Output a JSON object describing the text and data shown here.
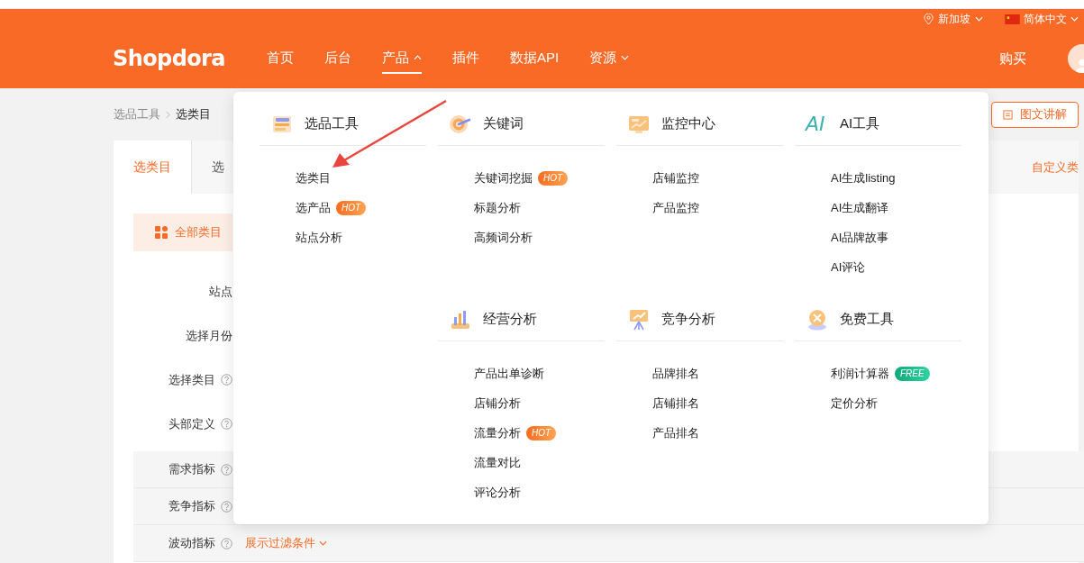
{
  "top_bar": {
    "region": "新加坡",
    "language": "简体中文"
  },
  "nav": {
    "logo": "Shopdora",
    "items": [
      {
        "label": "首页",
        "selected": false,
        "dropdown": false
      },
      {
        "label": "后台",
        "selected": false,
        "dropdown": false
      },
      {
        "label": "产品",
        "selected": true,
        "dropdown": true
      },
      {
        "label": "插件",
        "selected": false,
        "dropdown": false
      },
      {
        "label": "数据API",
        "selected": false,
        "dropdown": false
      },
      {
        "label": "资源",
        "selected": false,
        "dropdown": true
      }
    ],
    "buy": "购买"
  },
  "breadcrumb": [
    "选品工具",
    "选类目"
  ],
  "guide_button": "图文讲解",
  "tabs": [
    {
      "label": "选类目",
      "selected": true
    },
    {
      "label": "选",
      "selected": false
    }
  ],
  "custom_link": "自定义类",
  "category_button": "全部类目",
  "form_fields": [
    {
      "label": "站点",
      "help": false
    },
    {
      "label": "选择月份",
      "help": false
    },
    {
      "label": "选择类目",
      "help": true
    },
    {
      "label": "头部定义",
      "help": true
    }
  ],
  "filter_rows": [
    {
      "label": "需求指标"
    },
    {
      "label": "竞争指标"
    },
    {
      "label": "波动指标",
      "toggle": "展示过滤条件"
    }
  ],
  "menu": {
    "rows": [
      [
        {
          "title": "选品工具",
          "kind": "list",
          "items": [
            {
              "label": "选类目"
            },
            {
              "label": "选产品",
              "badge": {
                "text": "HOT",
                "kind": "hot"
              }
            },
            {
              "label": "站点分析"
            }
          ]
        },
        {
          "title": "关键词",
          "kind": "target",
          "items": [
            {
              "label": "关键词挖掘",
              "badge": {
                "text": "HOT",
                "kind": "hot"
              }
            },
            {
              "label": "标题分析"
            },
            {
              "label": "高频词分析"
            }
          ]
        },
        {
          "title": "监控中心",
          "kind": "monitor",
          "items": [
            {
              "label": "店铺监控"
            },
            {
              "label": "产品监控"
            }
          ]
        },
        {
          "title": "AI工具",
          "kind": "ai",
          "icon_text": "AI",
          "items": [
            {
              "label": "AI生成listing"
            },
            {
              "label": "AI生成翻译"
            },
            {
              "label": "AI品牌故事"
            },
            {
              "label": "AI评论"
            }
          ]
        }
      ],
      [
        "",
        {
          "title": "经营分析",
          "kind": "bars",
          "items": [
            {
              "label": "产品出单诊断"
            },
            {
              "label": "店铺分析"
            },
            {
              "label": "流量分析",
              "badge": {
                "text": "HOT",
                "kind": "hot"
              }
            },
            {
              "label": "流量对比"
            },
            {
              "label": "评论分析"
            }
          ]
        },
        {
          "title": "竞争分析",
          "kind": "easel",
          "items": [
            {
              "label": "品牌排名"
            },
            {
              "label": "店铺排名"
            },
            {
              "label": "产品排名"
            }
          ]
        },
        {
          "title": "免费工具",
          "kind": "coin",
          "items": [
            {
              "label": "利润计算器",
              "badge": {
                "text": "FREE",
                "kind": "free"
              }
            },
            {
              "label": "定价分析"
            }
          ]
        }
      ]
    ]
  }
}
